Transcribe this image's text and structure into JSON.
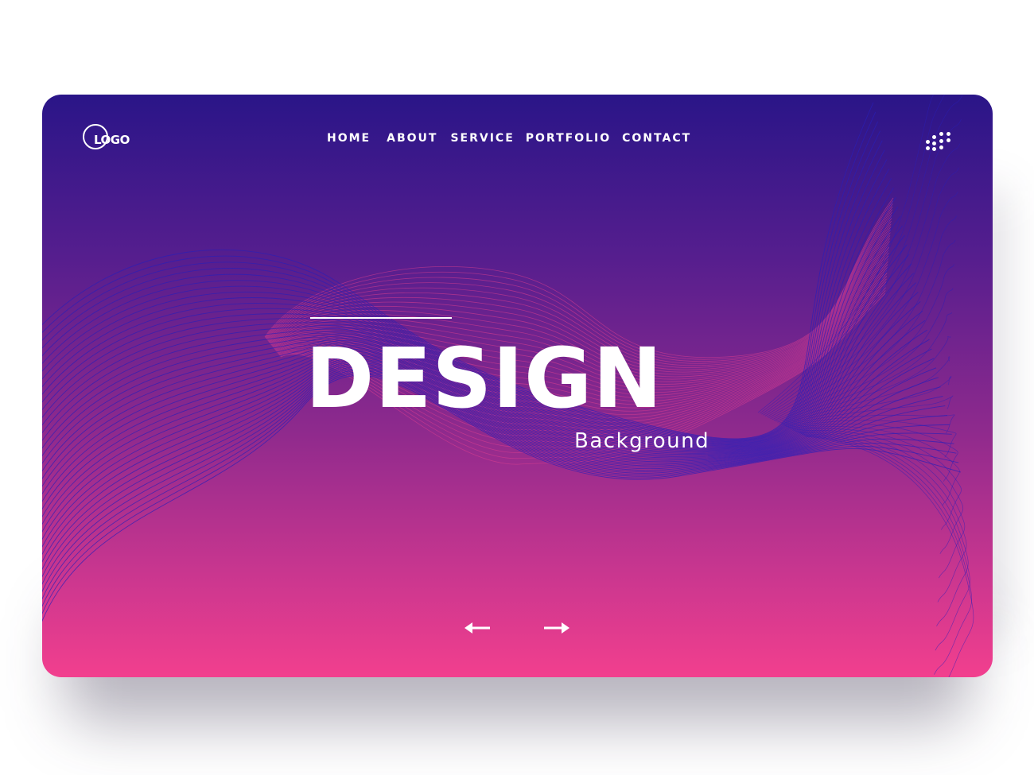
{
  "logo": {
    "text": "LOGO"
  },
  "nav": {
    "items": [
      {
        "label": "HOME"
      },
      {
        "label": "ABOUT"
      },
      {
        "label": "SERVICE"
      },
      {
        "label": "PORTFOLIO"
      },
      {
        "label": "CONTACT"
      }
    ]
  },
  "hero": {
    "title": "DESIGN",
    "subtitle": "Background"
  },
  "controls": {
    "prev_icon": "arrow-left-icon",
    "next_icon": "arrow-right-icon",
    "menu_icon": "dots-grid-icon"
  },
  "colors": {
    "gradient_top": "#2a1588",
    "gradient_bottom": "#f23f8e",
    "wave_blue": "#2a1fb8",
    "wave_pink": "#e0408f",
    "text": "#ffffff"
  }
}
